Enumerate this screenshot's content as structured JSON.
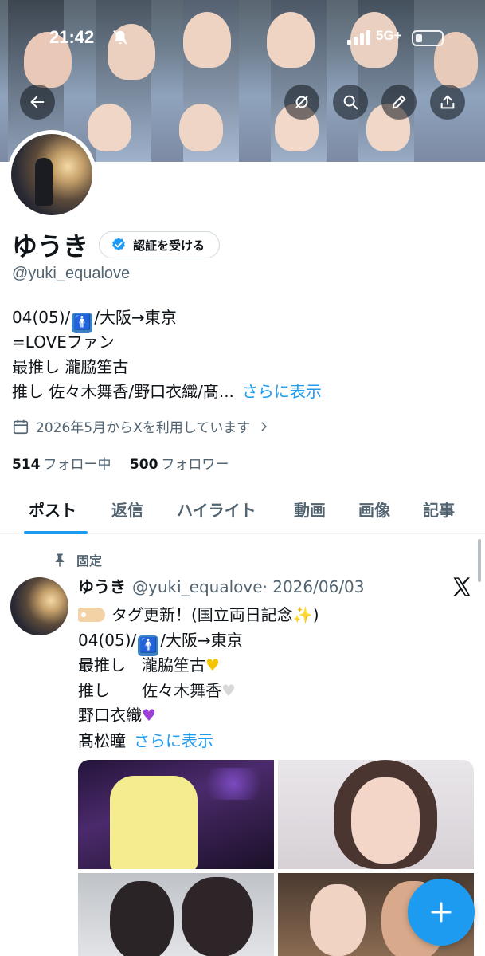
{
  "status_bar": {
    "time": "21:42",
    "network": "5G+",
    "bell_icon": "bell-slash-icon",
    "signal_icon": "signal-icon",
    "battery_icon": "battery-icon"
  },
  "header": {
    "back_icon": "arrow-left-icon",
    "grok_icon": "grok-icon",
    "search_icon": "search-icon",
    "edit_icon": "pencil-icon",
    "share_icon": "share-icon"
  },
  "profile": {
    "name": "ゆうき",
    "verify_button": "認証を受ける",
    "handle": "@yuki_equalove",
    "bio": {
      "line1_pre": "04(05)/",
      "line1_post": "/大阪→東京",
      "line2": "=LOVEファン",
      "line3": "最推し 瀧脇笙古",
      "line4": "推し 佐々木舞香/野口衣織/髙...",
      "more": "さらに表示"
    },
    "joined": "2026年5月からXを利用しています",
    "following_count": "514",
    "following_label": "フォロー中",
    "followers_count": "500",
    "followers_label": "フォロワー"
  },
  "tabs": [
    "ポスト",
    "返信",
    "ハイライト",
    "動画",
    "画像",
    "記事"
  ],
  "active_tab": "ポスト",
  "post": {
    "pinned_label": "固定",
    "author_name": "ゆうき",
    "author_handle": "@yuki_equalove",
    "separator": "·",
    "date": "2026/06/03",
    "line1": "タグ更新！(国立両日記念",
    "line1_end": ")",
    "line2_pre": "04(05)/",
    "line2_post": "/大阪→東京",
    "line3": "最推し　瀧脇笙古",
    "line4": "推し　　佐々木舞香",
    "line5": "野口衣織",
    "line6": "髙松瞳",
    "more": "さらに表示"
  },
  "colors": {
    "accent": "#1d9bf0",
    "text": "#0f1419",
    "secondary": "#536471"
  }
}
